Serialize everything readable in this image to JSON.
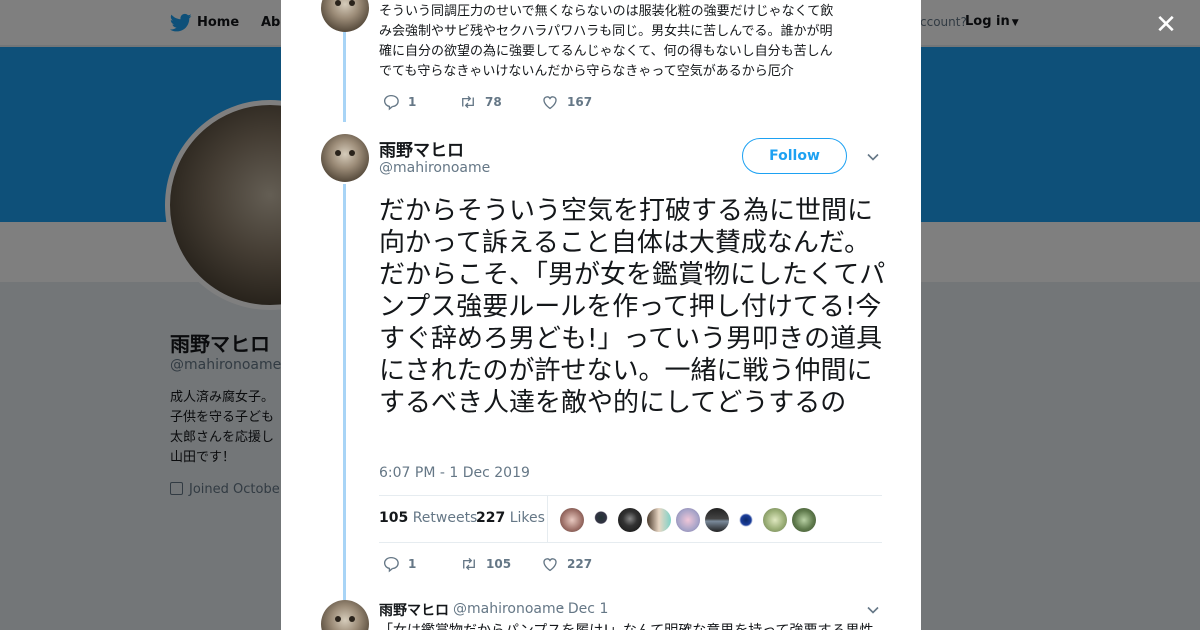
{
  "background": {
    "nav": {
      "home": "Home",
      "about": "Abo",
      "account": "ccount?",
      "login": "Log in"
    },
    "profile": {
      "name": "雨野マヒロ",
      "handle": "@mahironoame",
      "bio": "成人済み腐女子。\n子供を守る子ども\n太郎さんを応援し\n山田です！",
      "joined": "Joined Octobe"
    }
  },
  "colors": {
    "accent": "#1da1f2",
    "thread_line": "#a8d4f6",
    "muted": "#657786"
  },
  "prev_tweet": {
    "text_lines": [
      "そういう同調圧力のせいで無くならないのは服装化粧の強要だけじゃなくて飲",
      "み会強制やサビ残やセクハラパワハラも同じ。男女共に苦しんでる。誰かが明",
      "確に自分の欲望の為に強要してるんじゃなくて、何の得もないし自分も苦しん",
      "でても守らなきゃいけないんだから守らなきゃって空気があるから厄介"
    ],
    "replies": "1",
    "retweets": "78",
    "likes": "167"
  },
  "main_tweet": {
    "name": "雨野マヒロ",
    "handle": "@mahironoame",
    "follow_label": "Follow",
    "text": "だからそういう空気を打破する為に世間に向かって訴えること自体は大賛成なんだ。だからこそ、「男が女を鑑賞物にしたくてパンプス強要ルールを作って押し付けてる!今すぐ辞めろ男ども!」っていう男叩きの道具にされたのが許せない。一緒に戦う仲間にするべき人達を敵や的にしてどうするの",
    "time": "6:07 PM - 1 Dec 2019",
    "retweets_count": "105",
    "retweets_label": "Retweets",
    "likes_count": "227",
    "likes_label": "Likes",
    "replies": "1",
    "retweets": "105",
    "likes": "227"
  },
  "reply_tweet": {
    "name": "雨野マヒロ",
    "handle": "@mahironoame",
    "date": "· Dec 1",
    "text": "「女は鑑賞物だからパンプスを履け!」なんて明確な意思を持って強要する男性"
  },
  "icons": {
    "close": "close-icon",
    "reply": "reply-icon",
    "retweet": "retweet-icon",
    "like": "heart-icon",
    "more": "chevron-down-icon",
    "bird": "twitter-bird-icon"
  }
}
